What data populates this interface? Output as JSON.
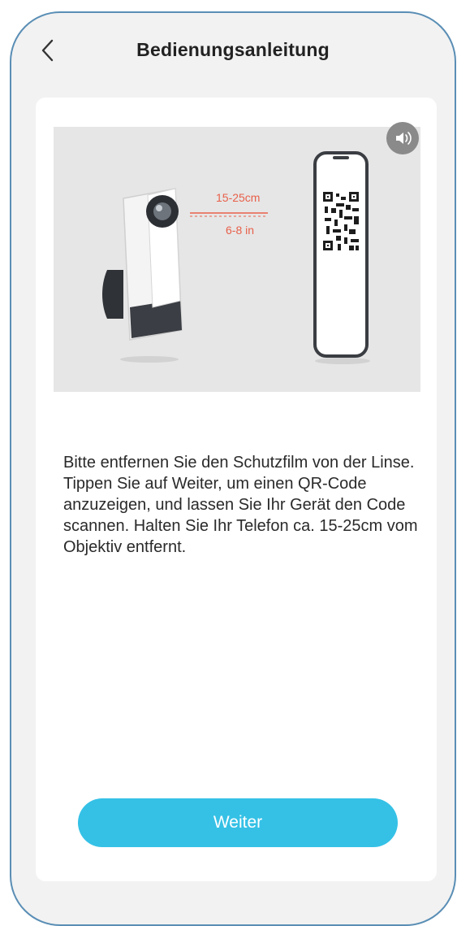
{
  "header": {
    "back_icon": "chevron-left-icon",
    "title": "Bedienungsanleitung"
  },
  "illustration": {
    "distance_cm": "15-25cm",
    "distance_in": "6-8 in",
    "sound_icon": "speaker-icon"
  },
  "instruction_text": "Bitte entfernen Sie den Schutzfilm von der Linse. Tippen Sie auf Weiter, um einen QR-Code anzuzeigen, und lassen Sie Ihr Gerät den Code scannen. Halten Sie Ihr Telefon ca. 15-25cm vom Objektiv entfernt.",
  "next_button": "Weiter",
  "colors": {
    "accent": "#35c1e6",
    "frame_border": "#5a8eb5",
    "page_bg": "#f2f2f2",
    "distance_label": "#e8604a"
  }
}
